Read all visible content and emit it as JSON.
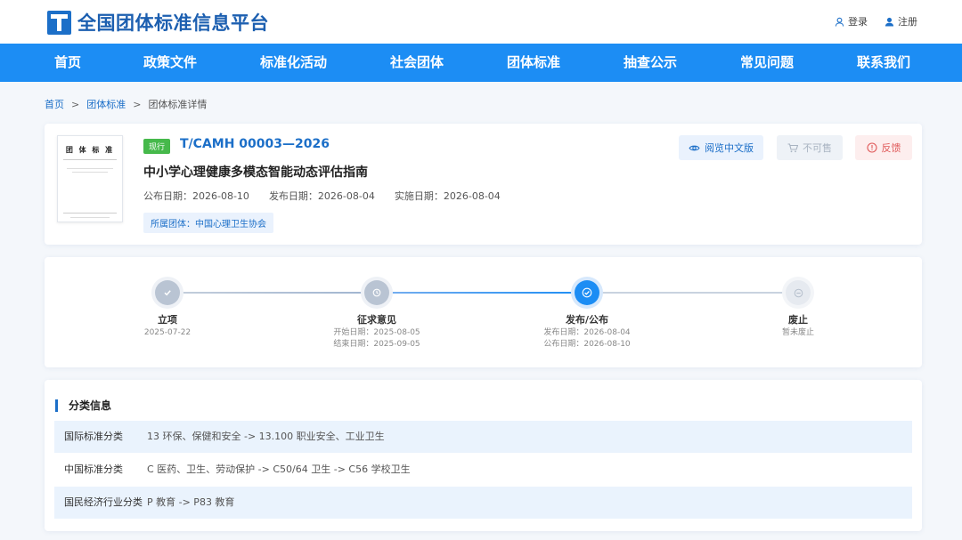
{
  "header": {
    "site_title": "全国团体标准信息平台",
    "login_label": "登录",
    "register_label": "注册"
  },
  "nav": {
    "items": [
      "首页",
      "政策文件",
      "标准化活动",
      "社会团体",
      "团体标准",
      "抽查公示",
      "常见问题",
      "联系我们"
    ]
  },
  "breadcrumb": {
    "home": "首页",
    "section": "团体标准",
    "current": "团体标准详情",
    "separator": ">"
  },
  "standard": {
    "thumb_title": "团 体 标 准",
    "status": "现行",
    "code": "T/CAMH 00003—2026",
    "title": "中小学心理健康多模态智能动态评估指南",
    "announce_date": "公布日期：2026-08-10",
    "publish_date": "发布日期：2026-08-04",
    "effective_date": "实施日期：2026-08-04",
    "organization": "所属团体：中国心理卫生协会",
    "read_button": "阅览中文版",
    "buy_button": "不可售",
    "feedback_button": "反馈",
    "colors": {
      "accent": "#1c6fc8",
      "status_green": "#46b94b",
      "feedback_red": "#e05a5a"
    }
  },
  "timeline": {
    "steps": [
      {
        "label": "立项",
        "lines": [
          "2025-07-22"
        ]
      },
      {
        "label": "征求意见",
        "lines": [
          "开始日期：2025-08-05",
          "结束日期：2025-09-05"
        ]
      },
      {
        "label": "发布/公布",
        "lines": [
          "发布日期：2026-08-04",
          "公布日期：2026-08-10"
        ]
      },
      {
        "label": "废止",
        "lines": [
          "暂未废止"
        ]
      }
    ]
  },
  "classification": {
    "heading": "分类信息",
    "rows": [
      {
        "key": "国际标准分类",
        "value": "13 环保、保健和安全 -> 13.100 职业安全、工业卫生"
      },
      {
        "key": "中国标准分类",
        "value": "C 医药、卫生、劳动保护 -> C50/64 卫生 -> C56 学校卫生"
      },
      {
        "key": "国民经济行业分类",
        "value": "P 教育 -> P83 教育"
      }
    ]
  }
}
